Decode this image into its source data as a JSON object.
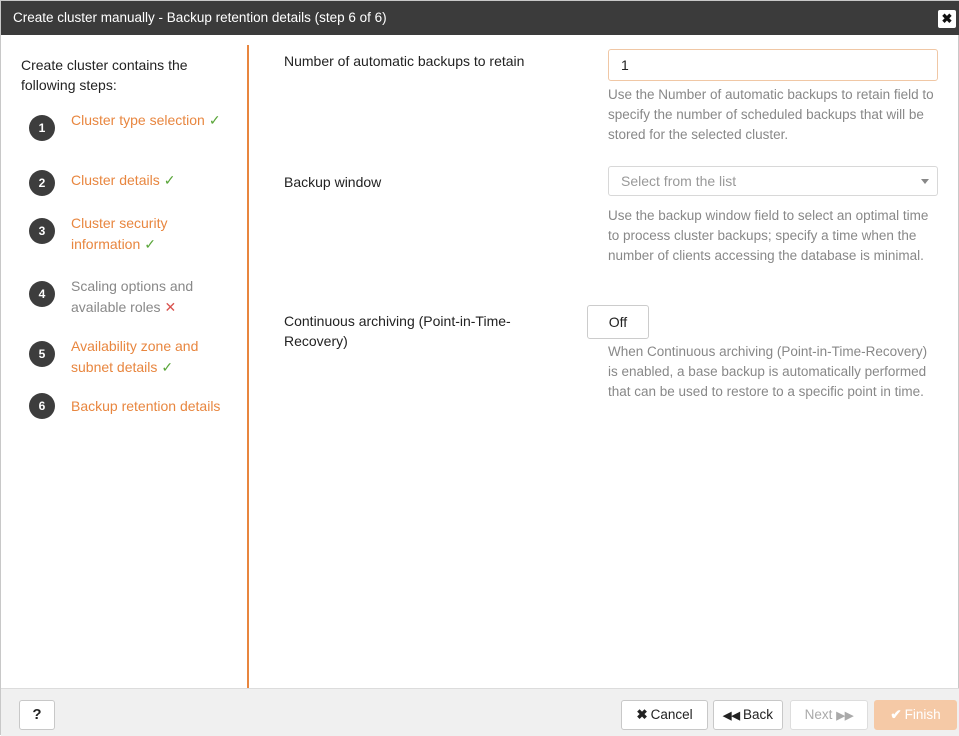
{
  "dialog": {
    "title": "Create cluster manually - Backup retention details (step 6 of 6)",
    "close_glyph": "✖"
  },
  "sidebar": {
    "intro": "Create cluster contains the following steps:",
    "steps": [
      {
        "num": "1",
        "label": "Cluster type selection",
        "status": "done"
      },
      {
        "num": "2",
        "label": "Cluster details",
        "status": "done"
      },
      {
        "num": "3",
        "label": "Cluster security information",
        "status": "done"
      },
      {
        "num": "4",
        "label": "Scaling options and available roles",
        "status": "error"
      },
      {
        "num": "5",
        "label": "Availability zone and subnet details",
        "status": "done"
      },
      {
        "num": "6",
        "label": "Backup retention details",
        "status": "current"
      }
    ],
    "check_glyph": "✓",
    "cross_glyph": "✕"
  },
  "form": {
    "backups": {
      "label": "Number of automatic backups to retain",
      "value": "1",
      "help": "Use the Number of automatic backups to retain field to specify the number of scheduled backups that will be stored for the selected cluster."
    },
    "window": {
      "label": "Backup window",
      "placeholder": "Select from the list",
      "help": "Use the backup window field to select an optimal time to process cluster backups; specify a time when the number of clients accessing the database is minimal."
    },
    "archiving": {
      "label": "Continuous archiving (Point-in-Time-Recovery)",
      "toggle": "Off",
      "help": "When Continuous archiving (Point-in-Time-Recovery) is enabled, a base backup is automatically performed that can be used to restore to a specific point in time."
    }
  },
  "footer": {
    "help": "?",
    "cancel": "Cancel",
    "back": "Back",
    "next": "Next",
    "finish": "Finish",
    "cancel_glyph": "✖",
    "back_glyph": "◀◀",
    "next_glyph": "▶▶",
    "finish_glyph": "✔"
  },
  "colors": {
    "accent": "#e8863f",
    "titlebar": "#3b3b3b",
    "check": "#5aa63a",
    "cross": "#d9534f",
    "step_circle": "#3d3d3d",
    "finish_disabled": "#f5c9a6"
  }
}
